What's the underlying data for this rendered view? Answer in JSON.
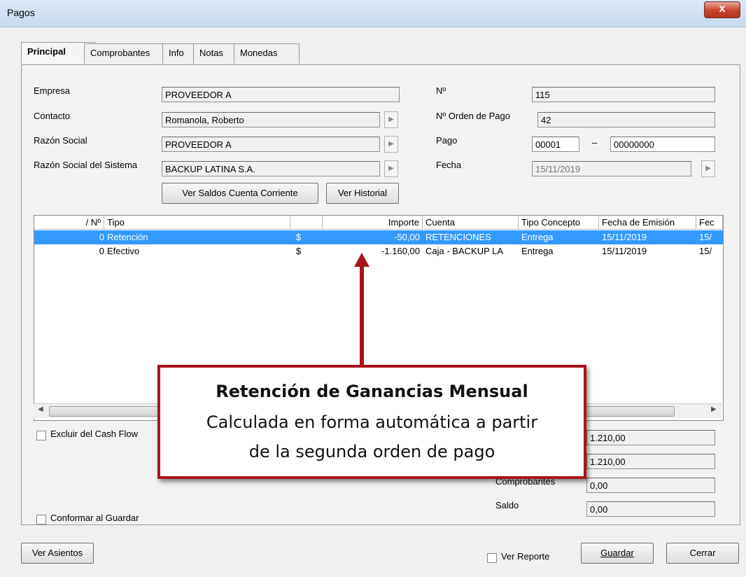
{
  "window": {
    "title": "Pagos",
    "close_glyph": "x"
  },
  "tabs": [
    "Principal",
    "Comprobantes",
    "Info",
    "Notas",
    "Monedas"
  ],
  "form": {
    "empresa_label": "Empresa",
    "empresa_value": "PROVEEDOR A",
    "contacto_label": "Contacto",
    "contacto_value": "Romanola, Roberto",
    "razon_label": "Razón Social",
    "razon_value": "PROVEEDOR A",
    "razon_sistema_label": "Razón Social del Sistema",
    "razon_sistema_value": "BACKUP LATINA S.A.",
    "nro_label": "Nº",
    "nro_value": "115",
    "orden_label": "Nº Orden de Pago",
    "orden_value": "42",
    "pago_label": "Pago",
    "pago_punto": "00001",
    "pago_sep": "–",
    "pago_numero": "00000000",
    "fecha_label": "Fecha",
    "fecha_value": "15/11/2019",
    "ver_saldos": "Ver Saldos Cuenta Corriente",
    "ver_historial": "Ver Historial"
  },
  "grid": {
    "headers": {
      "nro": "/  Nº",
      "tipo": "Tipo",
      "importe": "Importe",
      "cuenta": "Cuenta",
      "tipo_concepto": "Tipo Concepto",
      "fecha_emision": "Fecha de Emisión",
      "fec": "Fec"
    },
    "rows": [
      {
        "nro": "0",
        "tipo": "Retención",
        "moneda": "$",
        "importe": "-50,00",
        "cuenta": "RETENCIONES",
        "tipo_concepto": "Entrega",
        "fecha_emision": "15/11/2019",
        "fec": "15/"
      },
      {
        "nro": "0",
        "tipo": "Efectivo",
        "moneda": "$",
        "importe": "-1.160,00",
        "cuenta": "Caja - BACKUP LA",
        "tipo_concepto": "Entrega",
        "fecha_emision": "15/11/2019",
        "fec": "15/"
      }
    ]
  },
  "totals": {
    "total1": "1.210,00",
    "total2": "1.210,00",
    "comprobantes_label": "Comprobantes",
    "comprobantes_value": "0,00",
    "saldo_label": "Saldo",
    "saldo_value": "0,00"
  },
  "checks": {
    "excluir_cash_flow": "Excluir del Cash Flow",
    "conformar": "Conformar al Guardar",
    "ver_reporte": "Ver Reporte"
  },
  "buttons": {
    "ver_asientos": "Ver Asientos",
    "guardar": "Guardar",
    "cerrar": "Cerrar"
  },
  "callout": {
    "line1": "Retención de Ganancias Mensual",
    "line2": "Calculada en forma automática a partir",
    "line3": "de la segunda orden de pago"
  },
  "colors": {
    "selection": "#3399ff",
    "callout_border": "#a5161a"
  }
}
